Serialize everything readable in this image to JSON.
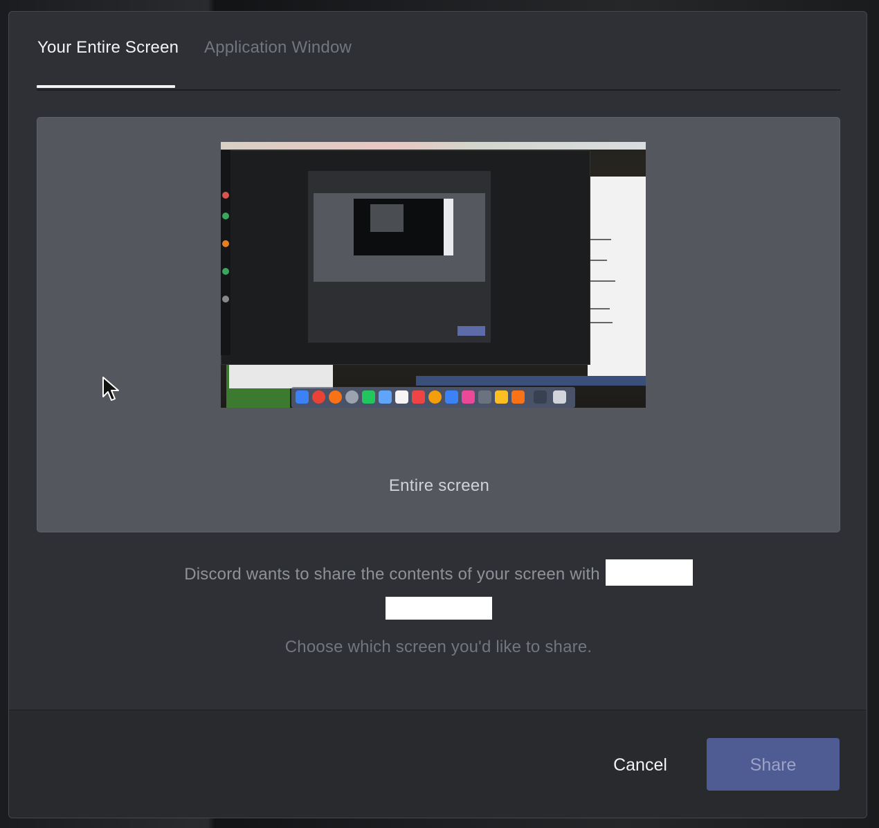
{
  "tabs": [
    {
      "label": "Your Entire Screen",
      "active": true
    },
    {
      "label": "Application Window",
      "active": false
    }
  ],
  "preview": {
    "label": "Entire screen"
  },
  "message": {
    "text": "Discord wants to share the contents of your screen with"
  },
  "hint": "Choose which screen you'd like to share.",
  "footer": {
    "cancel_label": "Cancel",
    "share_label": "Share"
  },
  "colors": {
    "modal_bg": "#2e3035",
    "card_bg": "#54575d",
    "share_button": "#4f5b93",
    "footer_bg": "#282a2e"
  },
  "icons": {
    "pointer": "mouse-pointer-icon"
  }
}
